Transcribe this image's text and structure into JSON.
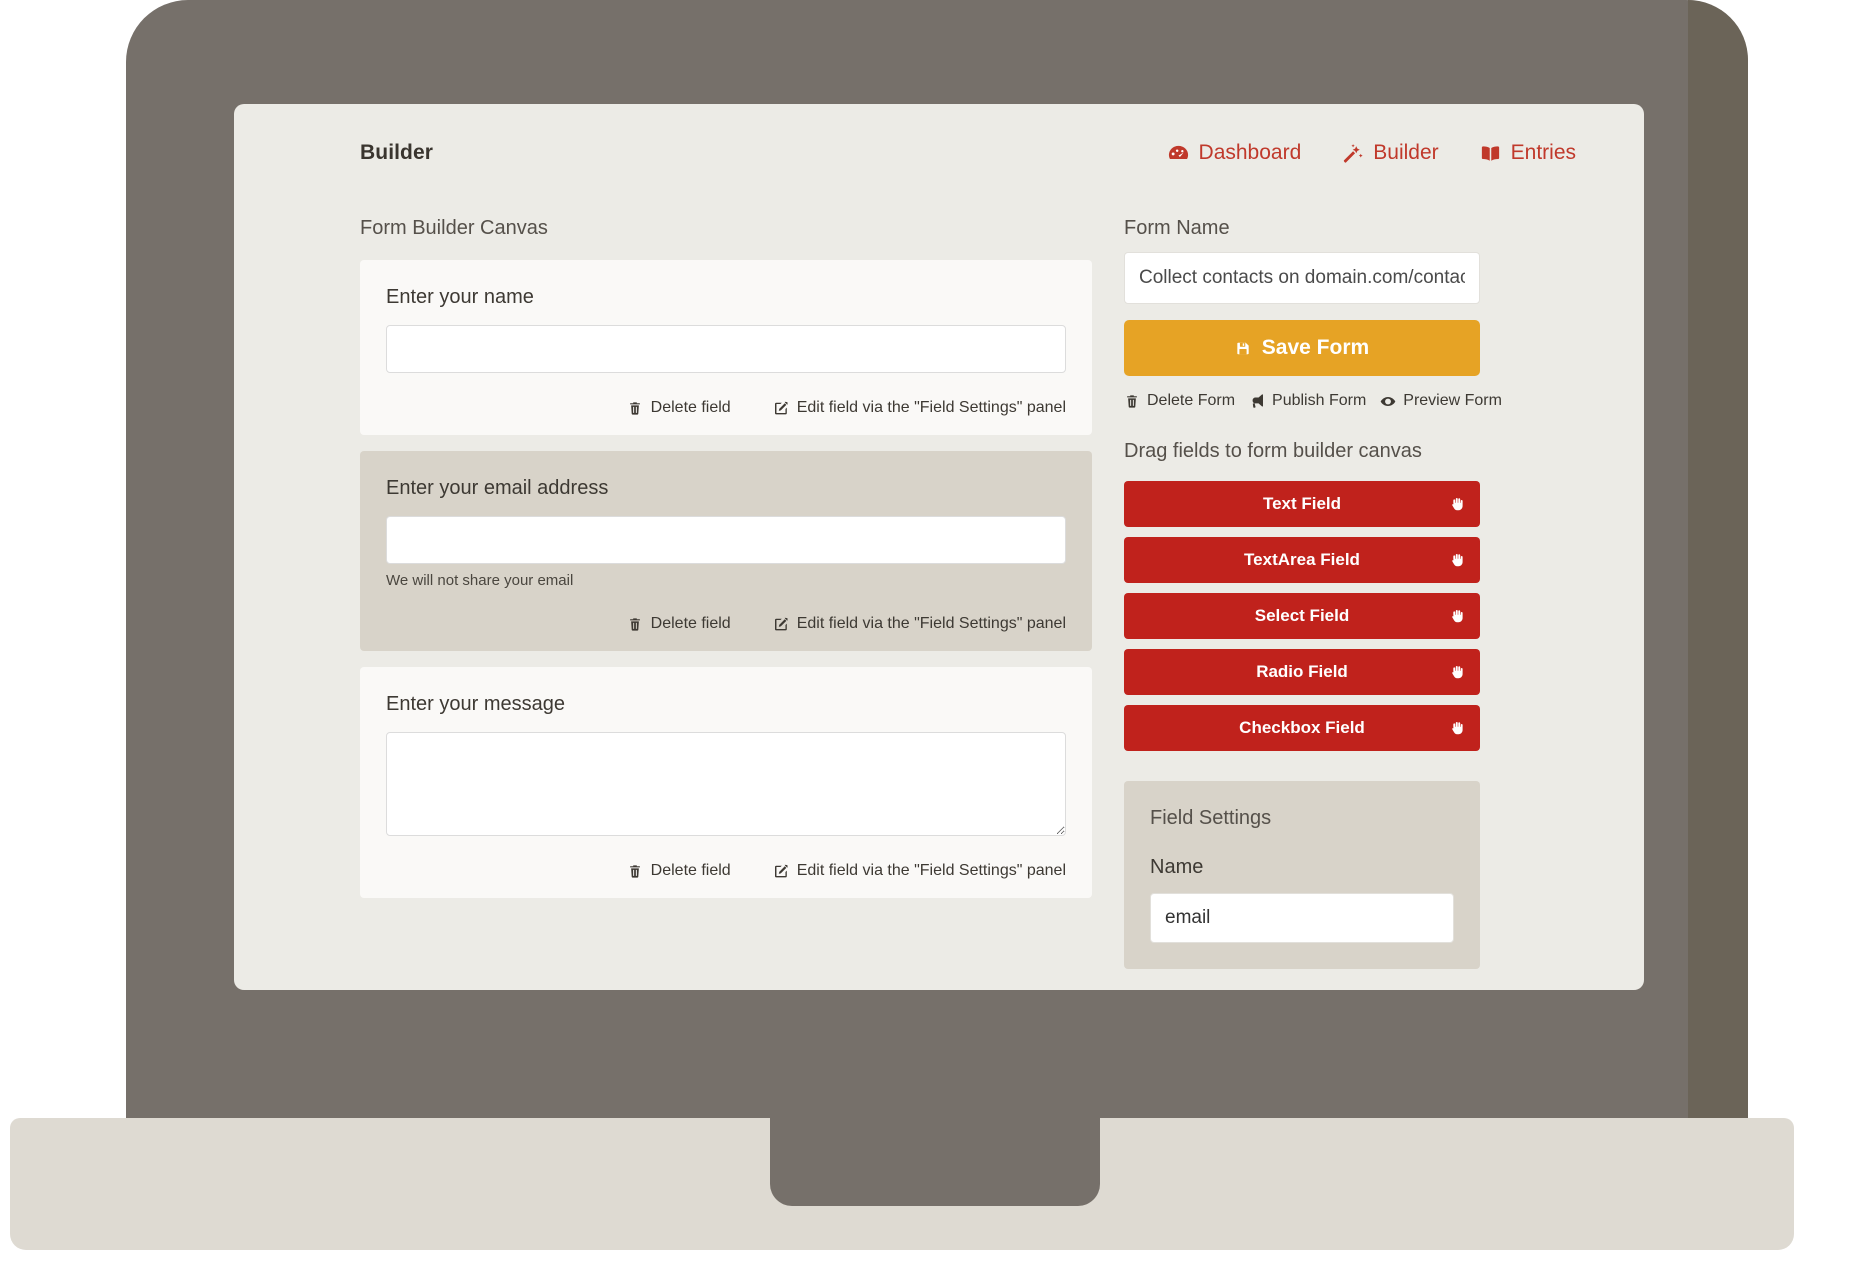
{
  "header": {
    "brand": "Builder",
    "nav": [
      {
        "label": "Dashboard",
        "icon": "tachometer-icon"
      },
      {
        "label": "Builder",
        "icon": "magic-wand-icon"
      },
      {
        "label": "Entries",
        "icon": "book-icon"
      }
    ]
  },
  "canvas": {
    "title": "Form Builder Canvas",
    "action_delete": "Delete field",
    "action_edit": "Edit field via the \"Field Settings\" panel",
    "fields": [
      {
        "label": "Enter your name",
        "type": "text",
        "value": "",
        "help": "",
        "selected": false
      },
      {
        "label": "Enter your email address",
        "type": "text",
        "value": "",
        "help": "We will not share your email",
        "selected": true
      },
      {
        "label": "Enter your message",
        "type": "textarea",
        "value": "",
        "help": "",
        "selected": false
      }
    ]
  },
  "sidebar": {
    "form_name_label": "Form Name",
    "form_name_value": "Collect contacts on domain.com/contact",
    "save_label": "Save Form",
    "form_actions": [
      {
        "label": "Delete Form",
        "icon": "trash-icon"
      },
      {
        "label": "Publish Form",
        "icon": "bullhorn-icon"
      },
      {
        "label": "Preview Form",
        "icon": "eye-icon"
      }
    ],
    "drag_title": "Drag fields to form builder canvas",
    "drag_fields": [
      {
        "label": "Text Field"
      },
      {
        "label": "TextArea Field"
      },
      {
        "label": "Select Field"
      },
      {
        "label": "Radio Field"
      },
      {
        "label": "Checkbox Field"
      }
    ],
    "field_settings": {
      "title": "Field Settings",
      "name_label": "Name",
      "name_value": "email"
    }
  },
  "colors": {
    "brand_red": "#c0392b",
    "drag_button_red": "#c0221c",
    "save_orange": "#e6a325",
    "bezel_gray": "#76706a",
    "screen_bg": "#ecebe6",
    "selected_card": "#d8d3c9"
  }
}
